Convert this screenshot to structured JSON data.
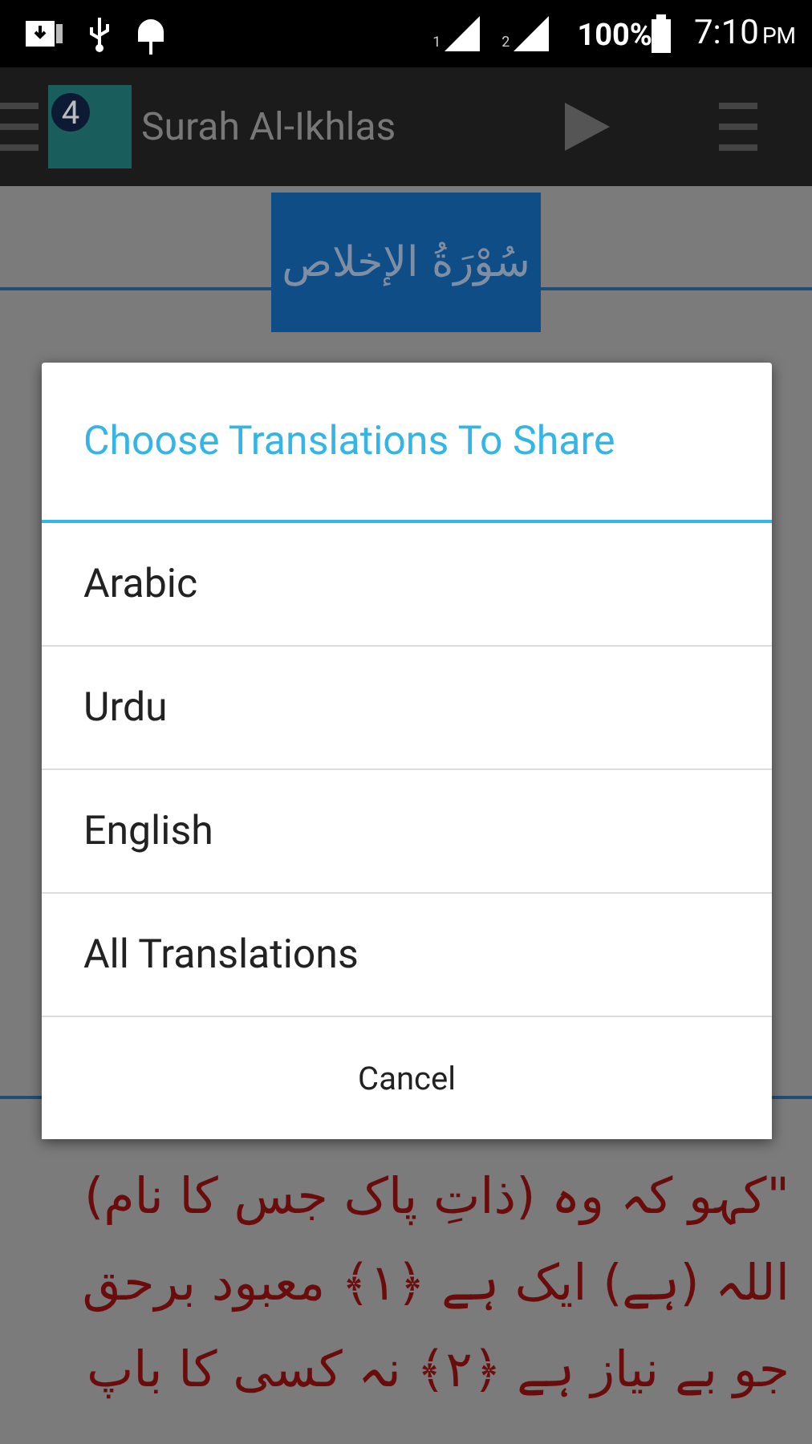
{
  "status_bar": {
    "sim_1_label": "1",
    "sim_2_label": "2",
    "battery": "100%",
    "time": "7:10",
    "meridiem": "PM"
  },
  "app_bar": {
    "logo_badge": "4",
    "title": "Surah Al-Ikhlas"
  },
  "surah_heading": "سُوْرَةُ الإخلاص",
  "translation_lines": [
    "\"کہو کہ وہ (ذاتِ پاک جس کا نام)",
    "اللہ (ہے) ایک ہے ﴿۱﴾ معبود برحق",
    "جو بے نیاز ہے ﴿۲﴾ نہ کسی کا باپ"
  ],
  "dialog": {
    "title": "Choose Translations To Share",
    "options": [
      "Arabic",
      "Urdu",
      "English",
      "All Translations"
    ],
    "cancel": "Cancel"
  }
}
